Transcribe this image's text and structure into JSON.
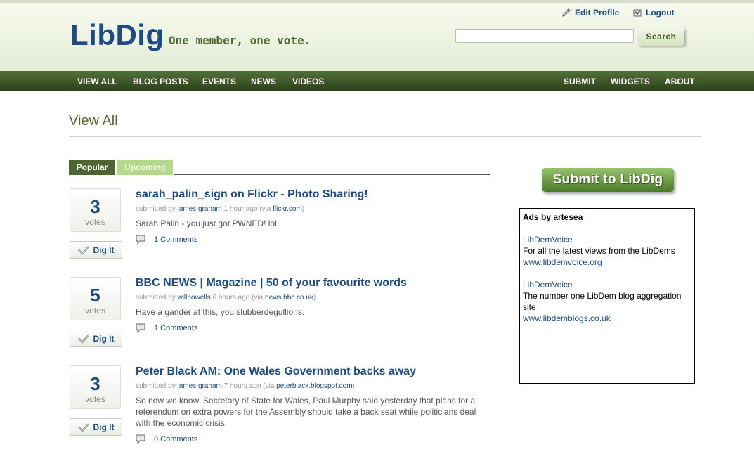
{
  "header": {
    "logo": "LibDig",
    "tagline": "One member, one vote.",
    "edit_profile": "Edit Profile",
    "logout": "Logout",
    "search_value": "",
    "search_button": "Search"
  },
  "nav": {
    "left": [
      "VIEW ALL",
      "BLOG POSTS",
      "EVENTS",
      "NEWS",
      "VIDEOS"
    ],
    "right": [
      "SUBMIT",
      "WIDGETS",
      "ABOUT"
    ]
  },
  "page_title": "View All",
  "tabs": {
    "popular": "Popular",
    "upcoming": "Upcoming"
  },
  "stories": [
    {
      "votes": "3",
      "votes_label": "votes",
      "dig_label": "Dig It",
      "title": "sarah_palin_sign on Flickr - Photo Sharing!",
      "submitted_by": "submitted by",
      "user": "james.graham",
      "time": "1 hour ago",
      "via": "(via",
      "source": "flickr.com",
      "close": ")",
      "description": "Sarah Palin - you just got PWNED! lol!",
      "comments": "1 Comments"
    },
    {
      "votes": "5",
      "votes_label": "votes",
      "dig_label": "Dig It",
      "title": "BBC NEWS | Magazine | 50 of your favourite words",
      "submitted_by": "submitted by",
      "user": "willhowells",
      "time": "6 hours ago",
      "via": "(via",
      "source": "news.bbc.co.uk",
      "close": ")",
      "description": "Have a gander at this, you slubberdegullions.",
      "comments": "1 Comments"
    },
    {
      "votes": "3",
      "votes_label": "votes",
      "dig_label": "Dig It",
      "title": "Peter Black AM: One Wales Government backs away",
      "submitted_by": "submitted by",
      "user": "james.graham",
      "time": "7 hours ago",
      "via": "(via",
      "source": "peterblack.blogspot.com",
      "close": ")",
      "description": "So now we know. Secretary of State for Wales, Paul Murphy said yesterday that plans for a referendum on extra powers for the Assembly should take a back seat while politicians deal with the economic crisis.",
      "comments": "0 Comments"
    }
  ],
  "sidebar": {
    "submit_button": "Submit to LibDig",
    "ads_title": "Ads by artesea",
    "ads": [
      {
        "name": "LibDemVoice",
        "text": "For all the latest views from the LibDems",
        "url": "www.libdemvoice.org"
      },
      {
        "name": "LibDemVoice",
        "text": "The number one LibDem blog aggregation site",
        "url": "www.libdemblogs.co.uk"
      }
    ]
  },
  "colors": {
    "brand_blue": "#1d4b86",
    "nav_green": "#3a5224",
    "accent_green": "#4d6b2a",
    "tab_upcoming": "#b3d88a"
  }
}
